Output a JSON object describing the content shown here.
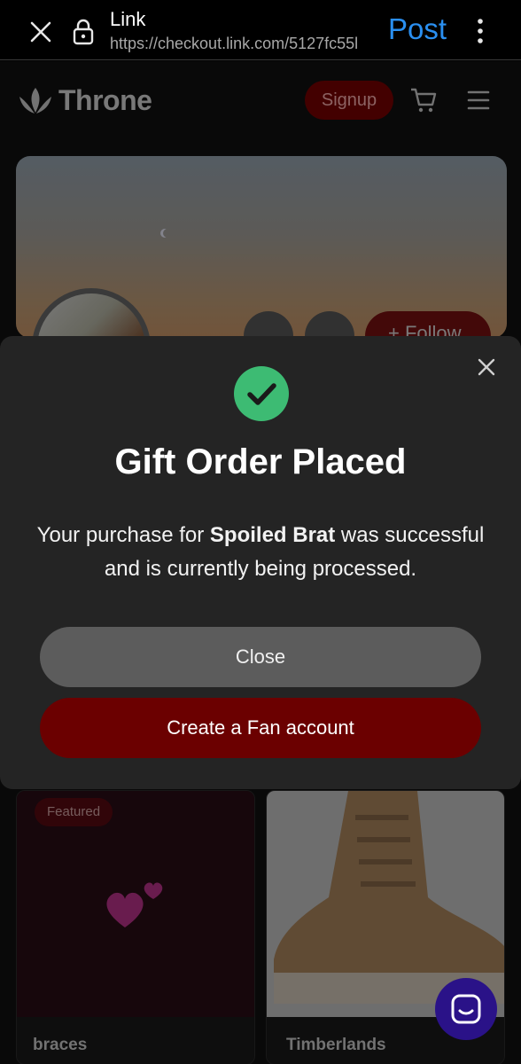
{
  "browser": {
    "title": "Link",
    "url": "https://checkout.link.com/5127fc55l",
    "post_label": "Post"
  },
  "site": {
    "logo_text": "Throne",
    "signup_label": "Signup",
    "follow_label": "+ Follow"
  },
  "modal": {
    "title": "Gift Order Placed",
    "message_prefix": "Your purchase for ",
    "item_name": "Spoiled Brat",
    "message_suffix": " was successful and is currently being processed.",
    "close_label": "Close",
    "fan_label": "Create a Fan account"
  },
  "products": [
    {
      "badge": "Featured",
      "name": "braces"
    },
    {
      "badge": "",
      "name": "Timberlands"
    }
  ],
  "colors": {
    "accent": "#6b0000",
    "success": "#3dbb73",
    "link_blue": "#2a8ff0",
    "chat": "#2a1288"
  },
  "icons": [
    "close-icon",
    "lock-icon",
    "more-vertical-icon",
    "throne-logo-icon",
    "cart-icon",
    "menu-icon",
    "share-icon",
    "search-icon",
    "check-circle-icon",
    "chat-icon"
  ]
}
